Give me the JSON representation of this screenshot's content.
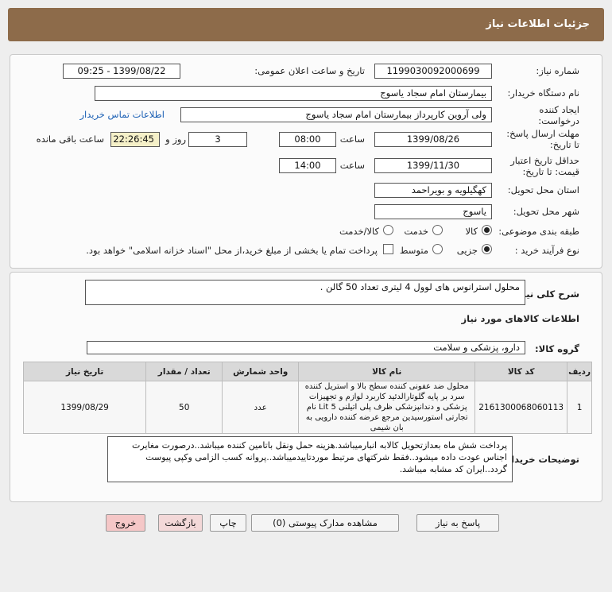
{
  "header": {
    "title": "جزئیات اطلاعات نیاز"
  },
  "info": {
    "need_number_label": "شماره نیاز:",
    "need_number": "1199030092000699",
    "announce_label": "تاریخ و ساعت اعلان عمومی:",
    "announce_value": "1399/08/22 - 09:25",
    "buyer_org_label": "نام دستگاه خریدار:",
    "buyer_org": "بیمارستان امام سجاد یاسوج",
    "creator_label": "ایجاد کننده درخواست:",
    "creator": "ولی آروین کارپرداز بیمارستان امام سجاد یاسوج",
    "contact_link": "اطلاعات تماس خریدار",
    "reply_deadline_label": "مهلت ارسال پاسخ: تا تاریخ:",
    "reply_date": "1399/08/26",
    "time_label": "ساعت",
    "reply_time": "08:00",
    "days_value": "3",
    "days_label": "روز و",
    "remaining_value": "22:26:45",
    "remaining_label": "ساعت باقی مانده",
    "validity_label": "حداقل تاریخ اعتبار قیمت: تا تاریخ:",
    "validity_date": "1399/11/30",
    "validity_time": "14:00",
    "province_label": "استان محل تحویل:",
    "province": "کهگیلویه و بویراحمد",
    "city_label": "شهر محل تحویل:",
    "city": "یاسوج",
    "category_label": "طبقه بندی موضوعی:",
    "category_options": [
      "کالا",
      "خدمت",
      "کالا/خدمت"
    ],
    "process_label": "نوع فرآیند خرید :",
    "process_options": [
      "جزیی",
      "متوسط"
    ],
    "payment_text": "پرداخت تمام یا بخشی از مبلغ خرید،از محل \"اسناد خزانه اسلامی\" خواهد بود."
  },
  "details": {
    "desc_label": "شرح کلی نیاز:",
    "desc_value": "محلول استرانوس های لوول 4 لیتری تعداد 50 گالن .",
    "goods_title": "اطلاعات کالاهای مورد نیاز",
    "group_label": "گروه کالا:",
    "group_value": "دارو، پزشکی و سلامت",
    "table": {
      "headers": [
        "ردیف",
        "کد کالا",
        "نام کالا",
        "واحد شمارش",
        "تعداد / مقدار",
        "تاریخ نیاز"
      ],
      "rows": [
        {
          "index": "1",
          "code": "2161300068060113",
          "name": "محلول ضد عفونی کننده سطح بالا و استریل کننده سرد بر پایه گلوتارالدئید کاربرد لوازم و تجهیزات پزشکی و دندانپزشکی ظرف پلی اتیلنی 5 Lit نام تجارتی استورسیدین مرجع عرضه کننده دارویی به بان شیمی",
          "unit": "عدد",
          "qty": "50",
          "date": "1399/08/29"
        }
      ]
    },
    "notes_label": "توضیحات خریدار:",
    "notes_value": "پرداخت شش ماه بعدازتحویل کالابه انبارمیباشد.هزینه حمل ونقل باتامین کننده میباشد..درصورت مغایرت اجناس عودت داده میشود..فقط شرکتهای مرتبط موردتاییدمیباشد..پروانه کسب الزامی وکپی پیوست گردد..ایران کد مشابه میباشد."
  },
  "buttons": {
    "reply": "پاسخ به نیاز",
    "attachments": "مشاهده مدارک پیوستی (0)",
    "print": "چاپ",
    "back": "بازگشت",
    "exit": "خروج"
  },
  "colors": {
    "header_bg": "#8d6b4a",
    "link": "#1a5fb4",
    "exit_btn": "#f5c7c7"
  }
}
